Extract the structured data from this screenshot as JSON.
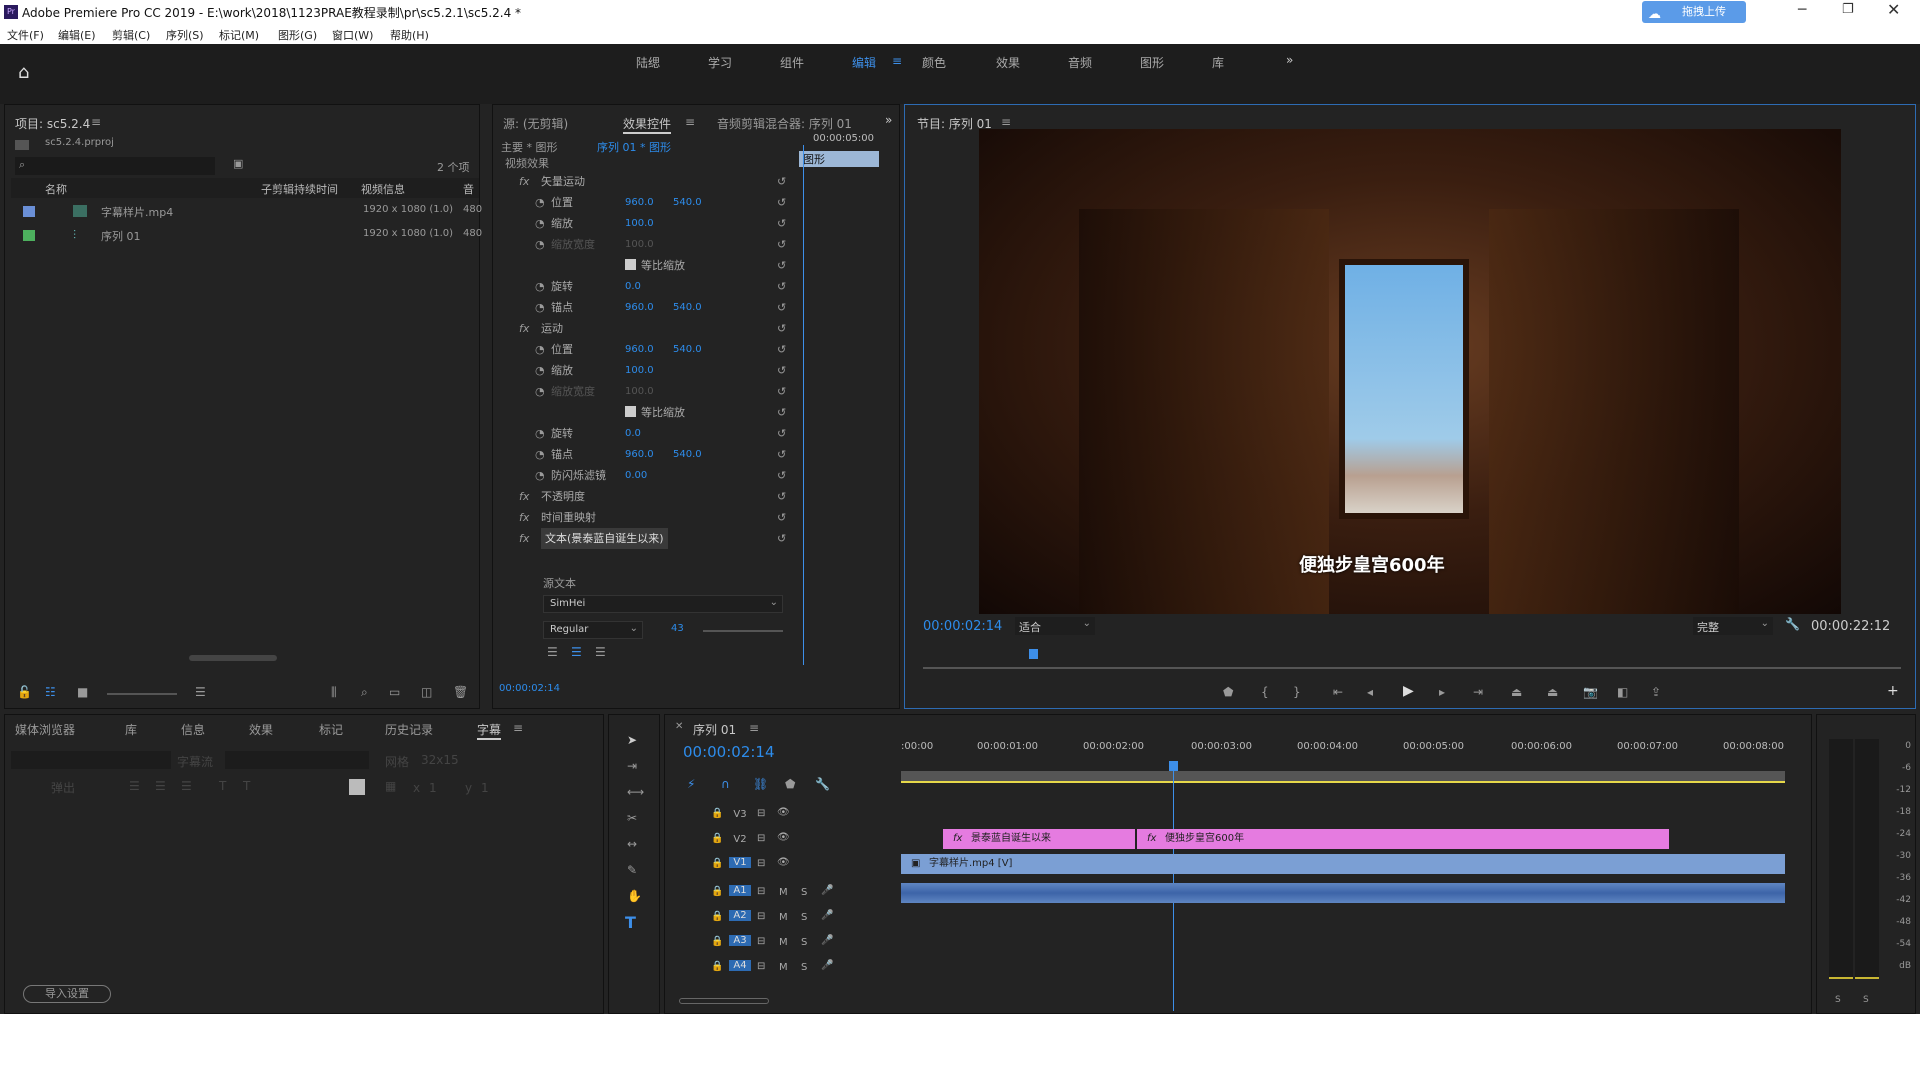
{
  "titlebar": {
    "title": "Adobe Premiere Pro CC 2019 - E:\\work\\2018\\1123PRAE教程录制\\pr\\sc5.2.1\\sc5.2.4 *",
    "upload_btn": "拖拽上传"
  },
  "menu": [
    "文件(F)",
    "编辑(E)",
    "剪辑(C)",
    "序列(S)",
    "标记(M)",
    "图形(G)",
    "窗口(W)",
    "帮助(H)"
  ],
  "workspaces": [
    "陆缌",
    "学习",
    "组件",
    "编辑",
    "颜色",
    "效果",
    "音频",
    "图形",
    "库"
  ],
  "project": {
    "title": "项目: sc5.2.4",
    "file": "sc5.2.4.prproj",
    "count": "2 个项",
    "headers": [
      "名称",
      "子剪辑持续时间",
      "视频信息",
      "音"
    ],
    "items": [
      {
        "name": "字幕样片.mp4",
        "info": "1920 x 1080 (1.0)",
        "audio": "480",
        "color": "#6a8fd6"
      },
      {
        "name": "序列 01",
        "info": "1920 x 1080 (1.0)",
        "audio": "480",
        "color": "#4db05e"
      }
    ]
  },
  "effects": {
    "tabs": [
      "源: (无剪辑)",
      "效果控件",
      "音频剪辑混合器: 序列 01"
    ],
    "master": "主要 * 图形",
    "seq": "序列 01 * 图形",
    "time": "00:00:05:00",
    "clip_label": "图形",
    "section": "视频效果",
    "rows": [
      {
        "label": "矢量运动",
        "v1": "",
        "v2": ""
      },
      {
        "label": "位置",
        "v1": "960.0",
        "v2": "540.0"
      },
      {
        "label": "缩放",
        "v1": "100.0",
        "v2": ""
      },
      {
        "label": "缩放宽度",
        "v1": "100.0",
        "v2": ""
      },
      {
        "label": "等比缩放",
        "v1": "",
        "v2": ""
      },
      {
        "label": "旋转",
        "v1": "0.0",
        "v2": ""
      },
      {
        "label": "锚点",
        "v1": "960.0",
        "v2": "540.0"
      },
      {
        "label": "运动",
        "v1": "",
        "v2": ""
      },
      {
        "label": "位置",
        "v1": "960.0",
        "v2": "540.0"
      },
      {
        "label": "缩放",
        "v1": "100.0",
        "v2": ""
      },
      {
        "label": "缩放宽度",
        "v1": "100.0",
        "v2": ""
      },
      {
        "label": "等比缩放",
        "v1": "",
        "v2": ""
      },
      {
        "label": "旋转",
        "v1": "0.0",
        "v2": ""
      },
      {
        "label": "锚点",
        "v1": "960.0",
        "v2": "540.0"
      },
      {
        "label": "防闪烁滤镜",
        "v1": "0.00",
        "v2": ""
      },
      {
        "label": "不透明度",
        "v1": "",
        "v2": ""
      },
      {
        "label": "时间重映射",
        "v1": "",
        "v2": ""
      },
      {
        "label": "文本(景泰蓝自诞生以来)",
        "v1": "",
        "v2": ""
      }
    ],
    "source_text": "源文本",
    "font": "SimHei",
    "style": "Regular",
    "size": "43",
    "timecode": "00:00:02:14"
  },
  "program": {
    "title": "节目: 序列 01",
    "subtitle": "便独步皇宫600年",
    "timecode": "00:00:02:14",
    "fit": "适合",
    "quality": "完整",
    "duration": "00:00:22:12"
  },
  "lower_tabs": [
    "媒体浏览器",
    "库",
    "信息",
    "效果",
    "标记",
    "历史记录",
    "字幕"
  ],
  "captions": {
    "stream_label": "字幕流",
    "grid_label": "网格",
    "grid_value": "32x15",
    "appear_label": "弹出",
    "import_btn": "导入设置",
    "x_label": "x",
    "x_value": "1",
    "y_label": "y",
    "y_value": "1"
  },
  "timeline": {
    "title": "序列 01",
    "timecode": "00:00:02:14",
    "ruler": [
      ":00:00",
      "00:00:01:00",
      "00:00:02:00",
      "00:00:03:00",
      "00:00:04:00",
      "00:00:05:00",
      "00:00:06:00",
      "00:00:07:00",
      "00:00:08:00"
    ],
    "tracks": [
      "V3",
      "V2",
      "V1",
      "A1",
      "A2",
      "A3",
      "A4"
    ],
    "clips": {
      "c1": "景泰蓝自诞生以来",
      "c2": "便独步皇宫600年",
      "v1": "字幕样片.mp4 [V]"
    }
  },
  "meter": [
    "0",
    "-6",
    "-12",
    "-18",
    "-24",
    "-30",
    "-36",
    "-42",
    "-48",
    "-54",
    "dB"
  ]
}
